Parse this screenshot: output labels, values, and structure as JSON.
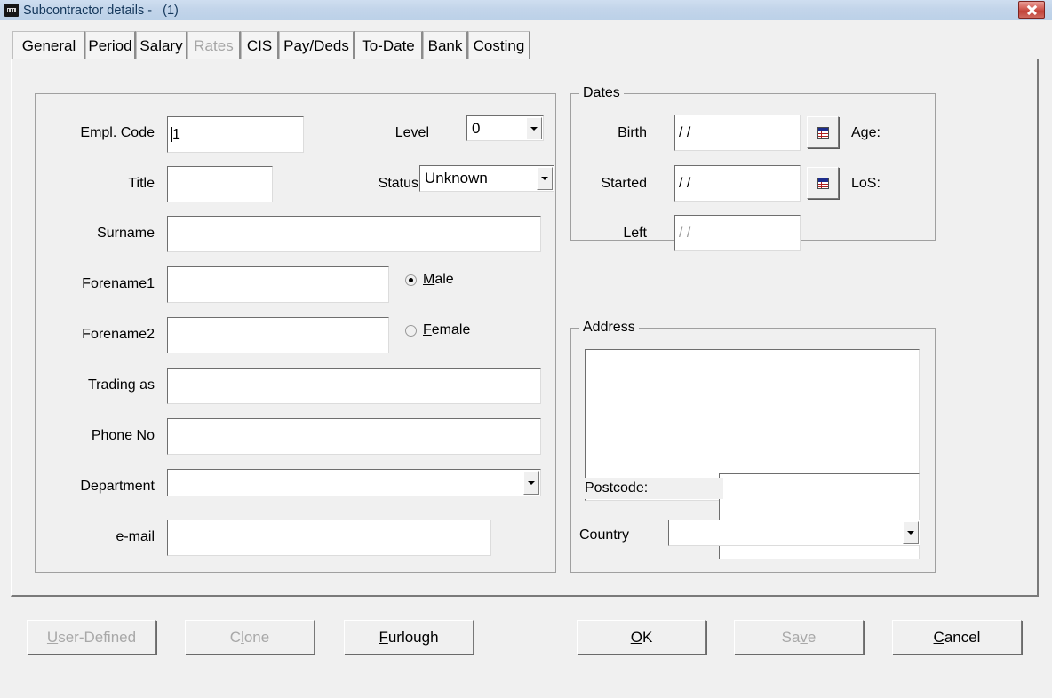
{
  "window": {
    "title": "Subcontractor details -   (1)",
    "icon": "app-icon",
    "close_label": "close-icon",
    "titlebar_color": "#c3d5ea",
    "title_text_color": "#14375b",
    "close_button_color": "#c2433a",
    "background_color": "#f0f0f0"
  },
  "tabs": [
    {
      "label": "General",
      "accel": "G",
      "selected": true,
      "enabled": true
    },
    {
      "label": "Period",
      "accel": "P",
      "selected": false,
      "enabled": true
    },
    {
      "label": "Salary",
      "accel": "a",
      "selected": false,
      "enabled": true
    },
    {
      "label": "Rates",
      "accel": "",
      "selected": false,
      "enabled": false
    },
    {
      "label": "CIS",
      "accel": "S",
      "selected": false,
      "enabled": true
    },
    {
      "label": "Pay/Deds",
      "accel": "D",
      "selected": false,
      "enabled": true
    },
    {
      "label": "To-Date",
      "accel": "e",
      "selected": false,
      "enabled": true
    },
    {
      "label": "Bank",
      "accel": "B",
      "selected": false,
      "enabled": true
    },
    {
      "label": "Costing",
      "accel": "i",
      "selected": false,
      "enabled": true
    }
  ],
  "general": {
    "empl_code": {
      "label": "Empl. Code",
      "value": "1"
    },
    "title": {
      "label": "Title",
      "value": ""
    },
    "surname": {
      "label": "Surname",
      "value": ""
    },
    "forename1": {
      "label": "Forename1",
      "value": ""
    },
    "forename2": {
      "label": "Forename2",
      "value": ""
    },
    "trading_as": {
      "label": "Trading as",
      "value": ""
    },
    "phone_no": {
      "label": "Phone No",
      "value": ""
    },
    "department": {
      "label": "Department",
      "value": ""
    },
    "email": {
      "label": "e-mail",
      "value": ""
    },
    "level": {
      "label": "Level",
      "value": "0"
    },
    "status": {
      "label": "Status",
      "value": "Unknown"
    },
    "gender": {
      "male": {
        "label": "Male",
        "accel": "M",
        "selected": true
      },
      "female": {
        "label": "Female",
        "accel": "F",
        "selected": false
      }
    }
  },
  "dates": {
    "group_title": "Dates",
    "birth": {
      "label": "Birth",
      "value": "/  /",
      "enabled": true
    },
    "started": {
      "label": "Started",
      "value": "/  /",
      "enabled": true
    },
    "left": {
      "label": "Left",
      "value": "/  /",
      "enabled": false
    },
    "age": {
      "label": "Age:",
      "value": ""
    },
    "los": {
      "label": "LoS:",
      "value": ""
    },
    "birth_picker_icon": "calendar-icon",
    "started_picker_icon": "calendar-icon"
  },
  "address": {
    "group_title": "Address",
    "lines": "",
    "postcode": {
      "label": "Postcode:",
      "value": ""
    },
    "country": {
      "label": "Country",
      "value": ""
    }
  },
  "buttons": [
    {
      "name": "user-defined",
      "label": "User-Defined",
      "accel": "U",
      "enabled": false
    },
    {
      "name": "clone",
      "label": "Clone",
      "accel": "l",
      "enabled": false
    },
    {
      "name": "furlough",
      "label": "Furlough",
      "accel": "F",
      "enabled": true
    },
    {
      "name": "ok",
      "label": "OK",
      "accel": "O",
      "enabled": true
    },
    {
      "name": "save",
      "label": "Save",
      "accel": "v",
      "enabled": false
    },
    {
      "name": "cancel",
      "label": "Cancel",
      "accel": "C",
      "enabled": true
    }
  ]
}
